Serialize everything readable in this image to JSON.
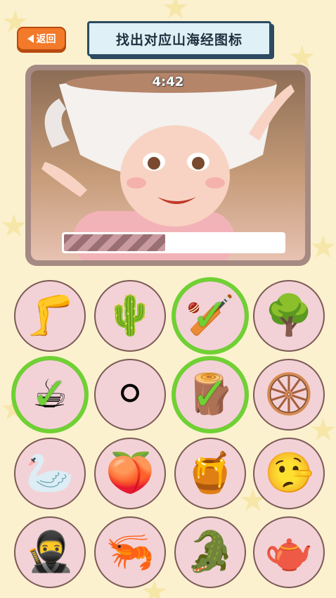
{
  "header": {
    "back_label": "返回",
    "title": "找出对应山海经图标"
  },
  "scene": {
    "timer": "4:42",
    "progress": 0.46
  },
  "tiles": [
    {
      "name": "leg",
      "glyph": "🦵",
      "found": false
    },
    {
      "name": "cactus",
      "glyph": "🌵",
      "found": false
    },
    {
      "name": "club",
      "glyph": "🏏",
      "found": true
    },
    {
      "name": "tree",
      "glyph": "🌳",
      "found": false
    },
    {
      "name": "coffee",
      "glyph": "☕",
      "found": true
    },
    {
      "name": "fluff-ball",
      "glyph": "⚪",
      "found": false
    },
    {
      "name": "log",
      "glyph": "🪵",
      "found": true
    },
    {
      "name": "tire",
      "glyph": "🛞",
      "found": false
    },
    {
      "name": "goose",
      "glyph": "🦢",
      "found": false
    },
    {
      "name": "peach",
      "glyph": "🍑",
      "found": false
    },
    {
      "name": "honey-jar",
      "glyph": "🍯",
      "found": false
    },
    {
      "name": "lying-face",
      "glyph": "🤥",
      "found": false
    },
    {
      "name": "ninja",
      "glyph": "🥷",
      "found": false
    },
    {
      "name": "shrimp",
      "glyph": "🦐",
      "found": false
    },
    {
      "name": "crocodile",
      "glyph": "🐊",
      "found": false
    },
    {
      "name": "teapot",
      "glyph": "🫖",
      "found": false
    }
  ]
}
